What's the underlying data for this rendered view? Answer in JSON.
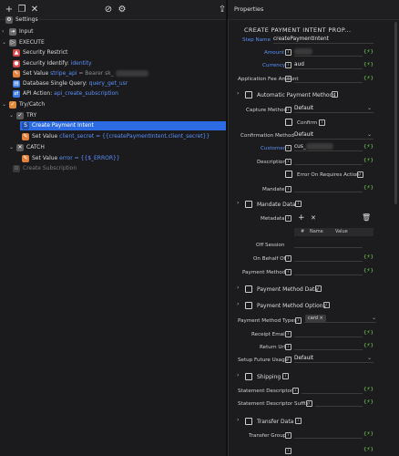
{
  "toolbar": {
    "icons": [
      "plus-icon",
      "copy-icon",
      "close-icon",
      "no-entry-icon",
      "gear-icon",
      "export-icon"
    ],
    "properties_tab": "Properties"
  },
  "tree": {
    "settings": "Settings",
    "input": "Input",
    "execute": "EXECUTE",
    "security_restrict": "Security Restrict",
    "security_identify_label": "Security Identify:",
    "security_identify_value": "identity",
    "set_value_label": "Set Value",
    "set_value_key": "stripe_api",
    "set_value_eq": "= Bearer sk_",
    "db_query_label": "Database Single Query:",
    "db_query_value": "query_get_usr",
    "api_action_label": "API Action:",
    "api_action_value": "api_create_subscription",
    "try_catch": "Try/Catch",
    "try": "TRY",
    "create_payment_intent": "Create Payment Intent",
    "set_value2_label": "Set Value",
    "set_value2_key": "client_secret",
    "set_value2_eq": "= {{createPaymentIntent.client_secret}}",
    "catch": "CATCH",
    "set_value3_label": "Set Value",
    "set_value3_key": "error",
    "set_value3_eq": "= {{$_ERROR}}",
    "create_subscription": "Create Subscription"
  },
  "properties": {
    "title": "CREATE PAYMENT INTENT PROP...",
    "step_name_label": "Step Name",
    "step_name_value": "createPaymentIntent",
    "amount_label": "Amount",
    "currency_label": "Currency",
    "currency_value": "aud",
    "app_fee_label": "Application Fee Amount",
    "auto_pm_label": "Automatic Payment Methods",
    "capture_method_label": "Capture Method",
    "capture_method_value": "Default",
    "confirm_label": "Confirm",
    "confirmation_method_label": "Confirmation Method",
    "confirmation_method_value": "Default",
    "customer_label": "Customer",
    "customer_value": "cus_",
    "description_label": "Description",
    "error_on_requires_action_label": "Error On Requires Action",
    "mandate_label": "Mandate",
    "mandate_data_label": "Mandate Data",
    "metadata_label": "Metadata",
    "metadata_col_hash": "#",
    "metadata_col_name": "Name",
    "metadata_col_value": "Value",
    "off_session_label": "Off Session",
    "on_behalf_of_label": "On Behalf Of",
    "payment_method_label": "Payment Method",
    "payment_method_data_label": "Payment Method Data",
    "payment_method_options_label": "Payment Method Options",
    "payment_method_types_label": "Payment Method Types",
    "payment_method_types_chip": "card",
    "receipt_email_label": "Receipt Email",
    "return_url_label": "Return Url",
    "setup_future_usage_label": "Setup Future Usage",
    "setup_future_usage_value": "Default",
    "shipping_label": "Shipping",
    "statement_descriptor_label": "Statement Descriptor",
    "statement_descriptor_suffix_label": "Statement Descriptor Suffix",
    "transfer_data_label": "Transfer Data",
    "transfer_group_label": "Transfer Group",
    "dynamic_glyph": "{⚡}",
    "info_glyph": "i"
  },
  "colors": {
    "accent_blue": "#5b8ff9",
    "selected_row": "#2d6be4",
    "dynamic_green": "#7ed957",
    "background": "#1b1b1d"
  }
}
